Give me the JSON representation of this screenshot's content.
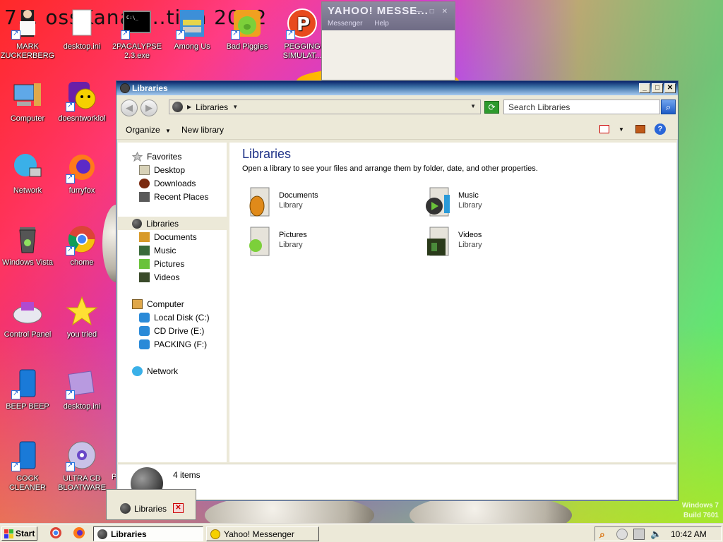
{
  "desktop": {
    "title_text": "7... ossKanae...tion 2012",
    "icons": [
      {
        "label": "MARK\nZUCKERBERG",
        "icon": "person-figure-icon"
      },
      {
        "label": "desktop.ini",
        "icon": "document-icon"
      },
      {
        "label": "2PACALYPSE\n2.3.exe",
        "icon": "console-icon"
      },
      {
        "label": "Among Us",
        "icon": "stacked-books-icon"
      },
      {
        "label": "Bad Piggies",
        "icon": "green-pig-icon"
      },
      {
        "label": "PEGGING\nSIMULAT...",
        "icon": "peg-letter-icon"
      },
      {
        "label": "Computer",
        "icon": "computer-icon"
      },
      {
        "label": "doesntworklol",
        "icon": "yahoo-smiley-icon"
      },
      {
        "label": "Network",
        "icon": "globe-network-icon"
      },
      {
        "label": "furryfox",
        "icon": "firefox-icon"
      },
      {
        "label": "Windows Vista",
        "icon": "recycle-bin-icon"
      },
      {
        "label": "chome",
        "icon": "chrome-icon"
      },
      {
        "label": "Control Panel",
        "icon": "control-panel-icon"
      },
      {
        "label": "you tried",
        "icon": "yellow-star-icon"
      },
      {
        "label": "BEEP BEEP",
        "icon": "blue-phone-icon"
      },
      {
        "label": "desktop.ini",
        "icon": "purple-doc-icon"
      },
      {
        "label": "COCK\nCLEANER",
        "icon": "blue-cleaner-icon"
      },
      {
        "label": "ULTRA CD\nBLOATWARE",
        "icon": "cd-disc-icon"
      }
    ],
    "partial_label": "P"
  },
  "yahoo_window": {
    "logo": "YAHOO! MESSE...",
    "menu": [
      "Messenger",
      "Help"
    ]
  },
  "explorer": {
    "title": "Libraries",
    "address": {
      "crumb": "Libraries"
    },
    "search_placeholder": "Search Libraries",
    "toolbar": {
      "organize": "Organize",
      "new_library": "New library"
    },
    "nav": {
      "favorites": "Favorites",
      "favorites_items": [
        "Desktop",
        "Downloads",
        "Recent Places"
      ],
      "libraries": "Libraries",
      "libraries_items": [
        "Documents",
        "Music",
        "Pictures",
        "Videos"
      ],
      "computer": "Computer",
      "computer_items": [
        "Local Disk (C:)",
        "CD Drive (E:)",
        "PACKING (F:)"
      ],
      "network": "Network"
    },
    "content": {
      "heading": "Libraries",
      "subheading": "Open a library to see your files and arrange them by folder, date, and other properties.",
      "tiles": [
        {
          "name": "Documents",
          "type": "Library",
          "icon": "documents-library-icon"
        },
        {
          "name": "Music",
          "type": "Library",
          "icon": "music-library-icon"
        },
        {
          "name": "Pictures",
          "type": "Library",
          "icon": "pictures-library-icon"
        },
        {
          "name": "Videos",
          "type": "Library",
          "icon": "videos-library-icon"
        }
      ]
    },
    "details": {
      "count": "4 items"
    }
  },
  "thumb_popup": {
    "label": "Libraries"
  },
  "watermark": {
    "line1": "Windows 7",
    "line2": "Build 7601"
  },
  "taskbar": {
    "start": "Start",
    "tasks": [
      {
        "label": "Libraries",
        "active": true
      },
      {
        "label": "Yahoo! Messenger",
        "active": false
      }
    ],
    "clock": "10:42 AM"
  }
}
